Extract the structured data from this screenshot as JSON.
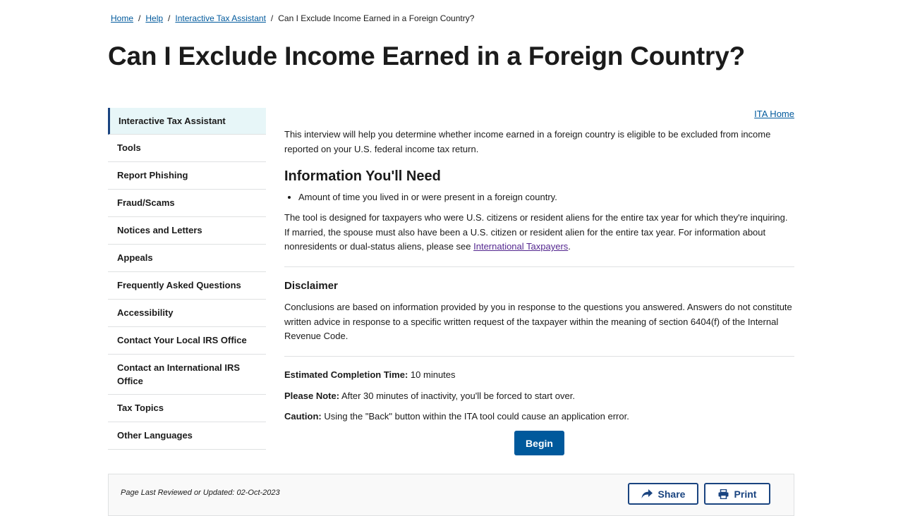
{
  "breadcrumb": {
    "home": "Home",
    "help": "Help",
    "ita": "Interactive Tax Assistant",
    "current": "Can I Exclude Income Earned in a Foreign Country?",
    "separator": "/"
  },
  "page_title": "Can I Exclude Income Earned in a Foreign Country?",
  "sidebar": {
    "items": [
      {
        "label": "Interactive Tax Assistant",
        "active": true
      },
      {
        "label": "Tools"
      },
      {
        "label": "Report Phishing"
      },
      {
        "label": "Fraud/Scams"
      },
      {
        "label": "Notices and Letters"
      },
      {
        "label": "Appeals"
      },
      {
        "label": "Frequently Asked Questions"
      },
      {
        "label": "Accessibility"
      },
      {
        "label": "Contact Your Local IRS Office"
      },
      {
        "label": "Contact an International IRS Office"
      },
      {
        "label": "Tax Topics"
      },
      {
        "label": "Other Languages"
      }
    ]
  },
  "main": {
    "ita_home_link": "ITA Home",
    "intro": "This interview will help you determine whether income earned in a foreign country is eligible to be excluded from income reported on your U.S. federal income tax return.",
    "info_heading": "Information You'll Need",
    "info_items": [
      "Amount of time you lived in or were present in a foreign country."
    ],
    "tool_text_before": "The tool is designed for taxpayers who were U.S. citizens or resident aliens for the entire tax year for which they're inquiring. If married, the spouse must also have been a U.S. citizen or resident alien for the entire tax year. For information about nonresidents or dual-status aliens, please see ",
    "tool_link": "International Taxpayers",
    "tool_text_after": ".",
    "disclaimer_heading": "Disclaimer",
    "disclaimer_text": "Conclusions are based on information provided by you in response to the questions you answered. Answers do not constitute written advice in response to a specific written request of the taxpayer within the meaning of section 6404(f) of the Internal Revenue Code.",
    "completion_label": "Estimated Completion Time:",
    "completion_value": "10 minutes",
    "note_label": "Please Note:",
    "note_value": "After 30 minutes of inactivity, you'll be forced to start over.",
    "caution_label": "Caution:",
    "caution_value": "Using the \"Back\" button within the ITA tool could cause an application error.",
    "begin_label": "Begin"
  },
  "footer": {
    "reviewed": "Page Last Reviewed or Updated: 02-Oct-2023",
    "share_label": "Share",
    "print_label": "Print"
  },
  "colors": {
    "link": "#00599c",
    "visited_link": "#54278f",
    "primary_button": "#00599c",
    "outline_button": "#1a4480",
    "sidebar_active_bg": "#e7f6f8"
  },
  "icons": {
    "share": "share-arrow-icon",
    "print": "printer-icon"
  }
}
